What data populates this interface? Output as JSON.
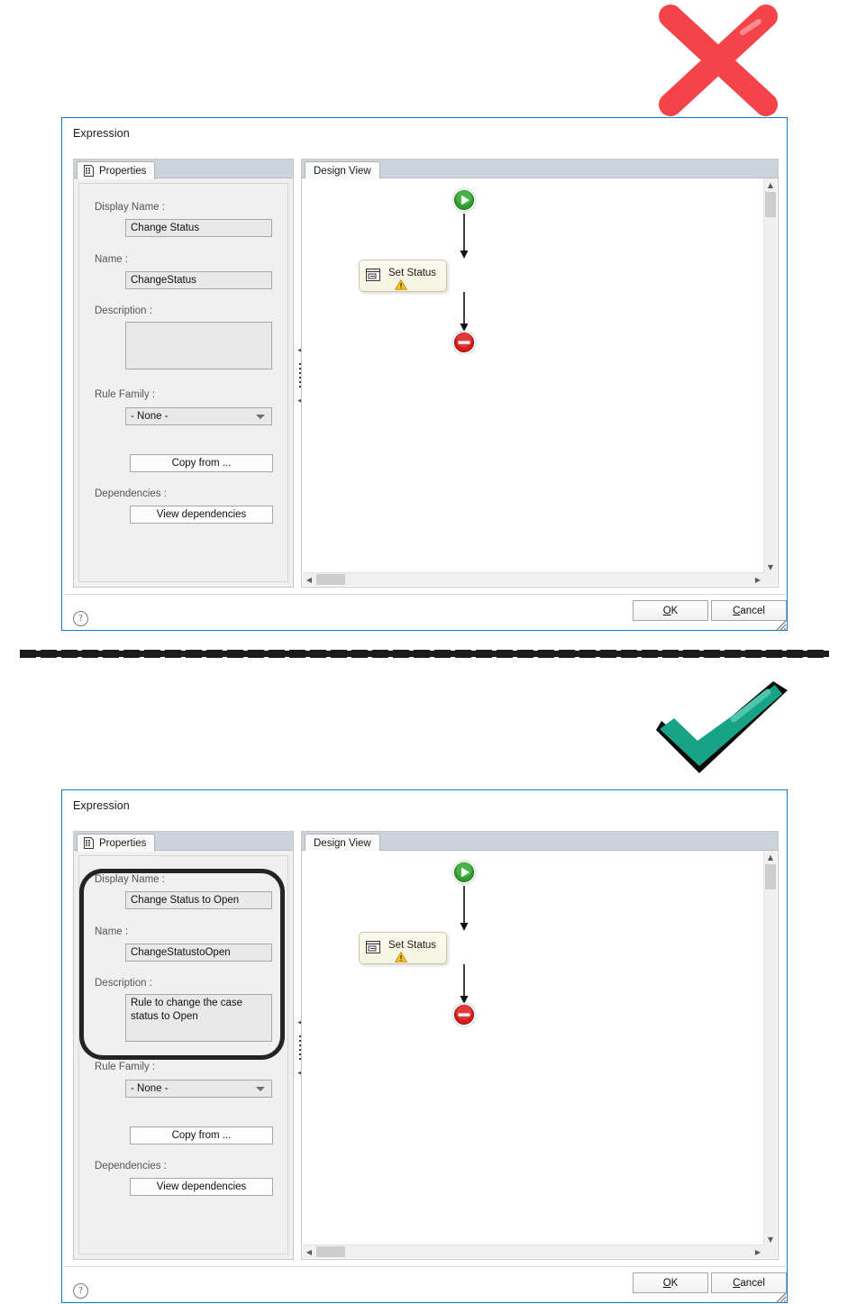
{
  "annotations": {
    "incorrect_mark": "red-x-mark",
    "correct_mark": "green-check-mark",
    "cut_line": "perforated-divider"
  },
  "dialogs": [
    {
      "id": "before",
      "title": "Expression",
      "properties_tab": {
        "label": "Properties",
        "icon": "properties-document-icon"
      },
      "design_tab": {
        "label": "Design View"
      },
      "fields": {
        "display_name_label": "Display Name :",
        "display_name_value": "Change Status",
        "name_label": "Name :",
        "name_value": "ChangeStatus",
        "description_label": "Description :",
        "description_value": "",
        "rule_family_label": "Rule Family :",
        "rule_family_value": "- None -",
        "copy_from_button": "Copy from ...",
        "dependencies_label": "Dependencies :",
        "view_dependencies_button": "View dependencies"
      },
      "flow": {
        "start_node": "start-node",
        "activity_label": "Set Status",
        "activity_icon": "set-status-icon",
        "warning_icon": "warning-triangle-icon",
        "end_node": "end-node"
      },
      "footer": {
        "help": "?",
        "ok_mnemonic": "O",
        "ok_rest": "K",
        "cancel_mnemonic": "C",
        "cancel_rest": "ancel"
      }
    },
    {
      "id": "after",
      "title": "Expression",
      "properties_tab": {
        "label": "Properties",
        "icon": "properties-document-icon"
      },
      "design_tab": {
        "label": "Design View"
      },
      "fields": {
        "display_name_label": "Display Name :",
        "display_name_value": "Change Status to Open",
        "name_label": "Name :",
        "name_value": "ChangeStatustoOpen",
        "description_label": "Description :",
        "description_value": "Rule to change the case status to Open",
        "rule_family_label": "Rule Family :",
        "rule_family_value": "- None -",
        "copy_from_button": "Copy from ...",
        "dependencies_label": "Dependencies :",
        "view_dependencies_button": "View dependencies"
      },
      "flow": {
        "start_node": "start-node",
        "activity_label": "Set Status",
        "activity_icon": "set-status-icon",
        "warning_icon": "warning-triangle-icon",
        "end_node": "end-node"
      },
      "footer": {
        "help": "?",
        "ok_mnemonic": "O",
        "ok_rest": "K",
        "cancel_mnemonic": "C",
        "cancel_rest": "ancel"
      }
    }
  ],
  "colors": {
    "dialog_border": "#1b78c4",
    "tabstrip": "#ccd3dd",
    "panel_bg": "#f0f0f0",
    "field_bg": "#e9e9e9",
    "label_text": "#555555",
    "red_x": "#f4444a",
    "green_check": "#17a387",
    "node_green": "#2f9e2f",
    "node_red": "#d81a1a",
    "highlight_ring": "#242424"
  }
}
